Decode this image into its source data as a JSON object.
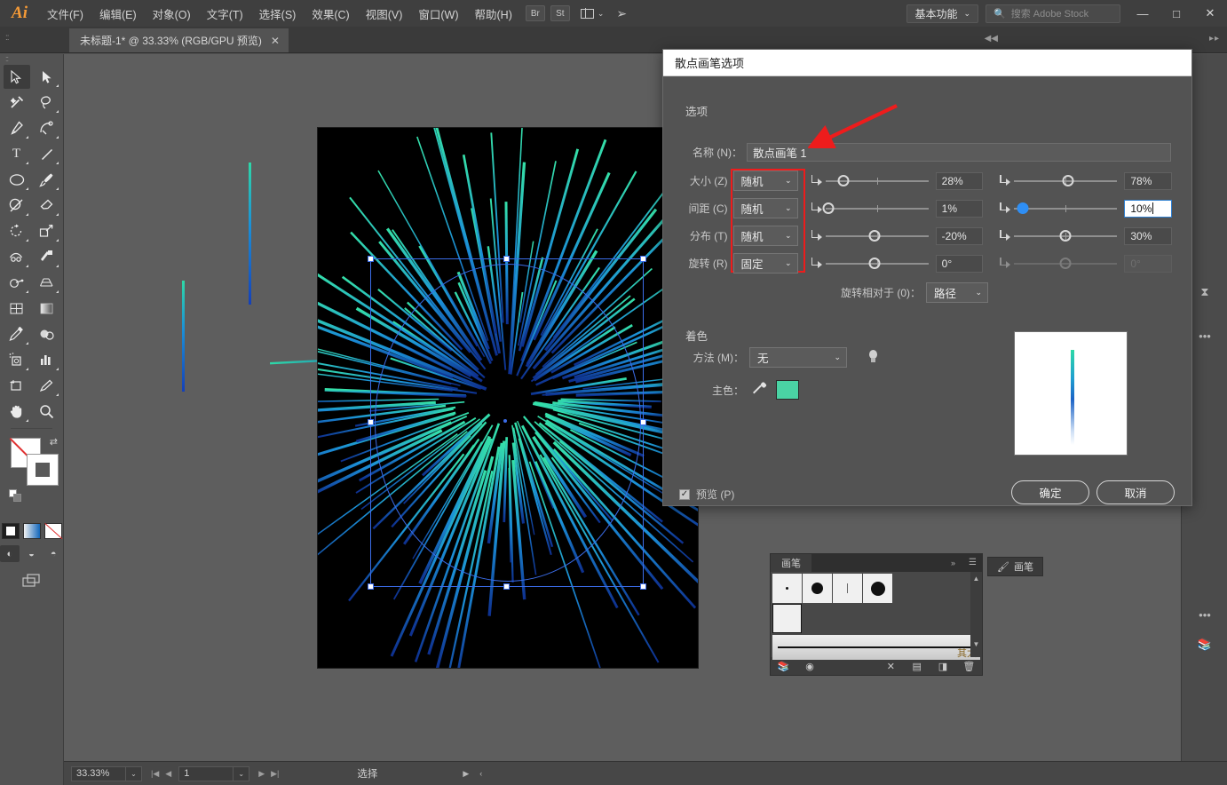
{
  "app": {
    "logo": "Ai",
    "menus": [
      "文件(F)",
      "编辑(E)",
      "对象(O)",
      "文字(T)",
      "选择(S)",
      "效果(C)",
      "视图(V)",
      "窗口(W)",
      "帮助(H)"
    ],
    "bridge_icon_label": "Br",
    "stock_icon_label": "St",
    "workspace": "基本功能",
    "search_placeholder": "搜索 Adobe Stock",
    "window_buttons": {
      "minimize": "—",
      "maximize": "□",
      "close": "✕"
    }
  },
  "document": {
    "tab_title": "未标题-1* @ 33.33% (RGB/GPU 预览)",
    "tab_close": "✕"
  },
  "statusbar": {
    "zoom": "33.33%",
    "page": "1",
    "status_text": "选择"
  },
  "brush_panel": {
    "tab_label": "画笔",
    "library_label": "其太",
    "float_tab_label": "画笔"
  },
  "dialog": {
    "title": "散点画笔选项",
    "options_section": "选项",
    "name_label": "名称 (N)：",
    "name_value": "散点画笔 1",
    "rows": [
      {
        "label": "大小 (Z)",
        "mode": "随机",
        "value1": "28%",
        "value2": "78%",
        "pos1": 18,
        "pos2": 52,
        "active2": false,
        "dim2": false
      },
      {
        "label": "间距 (C)",
        "mode": "随机",
        "value1": "1%",
        "value2": "10%",
        "pos1": 3,
        "pos2": 8,
        "active2": true,
        "dim2": false
      },
      {
        "label": "分布 (T)",
        "mode": "随机",
        "value1": "-20%",
        "value2": "30%",
        "pos1": 48,
        "pos2": 50,
        "active2": false,
        "dim2": false
      },
      {
        "label": "旋转 (R)",
        "mode": "固定",
        "value1": "0°",
        "value2": "0°",
        "pos1": 48,
        "pos2": 50,
        "active2": false,
        "dim2": true
      }
    ],
    "rotation_relative_label": "旋转相对于 (0)：",
    "rotation_relative_value": "路径",
    "colorization_section": "着色",
    "method_label": "方法 (M)：",
    "method_value": "无",
    "key_color_label": "主色：",
    "key_color_hex": "#4ad3a4",
    "preview_checkbox_label": "预览 (P)",
    "preview_checked": true,
    "ok_button": "确定",
    "cancel_button": "取消"
  },
  "colors": {
    "accent_blue": "#2f8ff5",
    "annotation_red": "#ee1c1c",
    "panel_bg": "#535353",
    "canvas_bg": "#5e5e5e",
    "artboard_bg": "#000000"
  },
  "tools": [
    "selection-tool",
    "direct-selection-tool",
    "magic-wand-tool",
    "lasso-tool",
    "pen-tool",
    "curvature-tool",
    "type-tool",
    "line-segment-tool",
    "ellipse-tool",
    "paintbrush-tool",
    "shaper-tool",
    "eraser-tool",
    "rotate-tool",
    "scale-tool",
    "width-tool",
    "free-transform-tool",
    "shape-builder-tool",
    "perspective-grid-tool",
    "mesh-tool",
    "gradient-tool",
    "eyedropper-tool",
    "blend-tool",
    "symbol-sprayer-tool",
    "column-graph-tool",
    "artboard-tool",
    "slice-tool",
    "hand-tool",
    "zoom-tool"
  ]
}
